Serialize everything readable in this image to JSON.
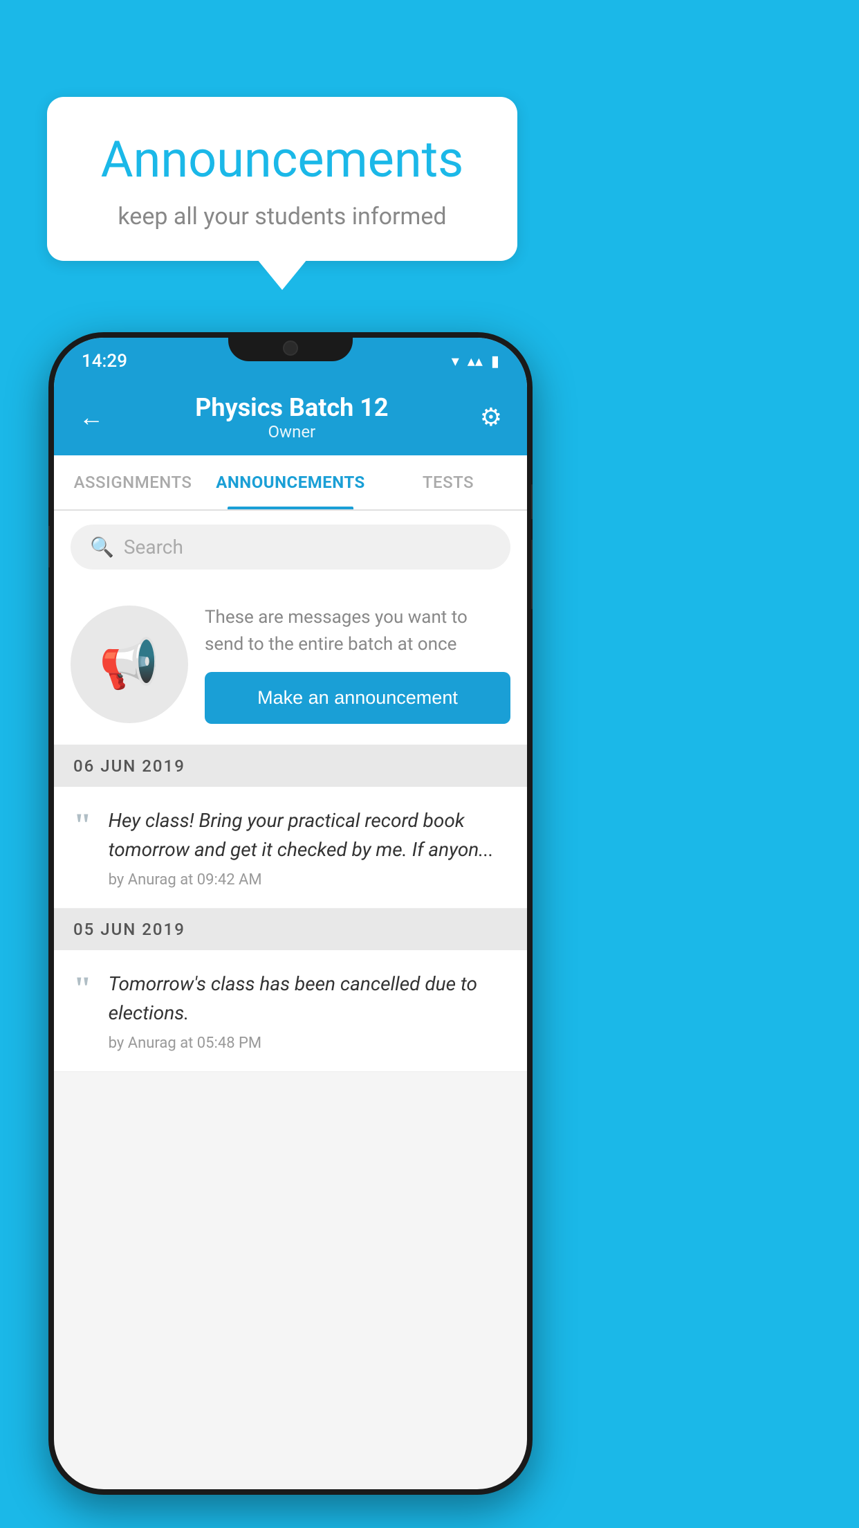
{
  "background_color": "#1bb8e8",
  "speech_bubble": {
    "title": "Announcements",
    "subtitle": "keep all your students informed"
  },
  "status_bar": {
    "time": "14:29",
    "wifi": "▾",
    "signal": "▴",
    "battery": "▮"
  },
  "header": {
    "title": "Physics Batch 12",
    "subtitle": "Owner",
    "back_label": "←",
    "settings_label": "⚙"
  },
  "tabs": [
    {
      "label": "ASSIGNMENTS",
      "active": false
    },
    {
      "label": "ANNOUNCEMENTS",
      "active": true
    },
    {
      "label": "TESTS",
      "active": false
    }
  ],
  "search": {
    "placeholder": "Search"
  },
  "promo": {
    "description": "These are messages you want to send to the entire batch at once",
    "button_label": "Make an announcement"
  },
  "date_sections": [
    {
      "date": "06  JUN  2019",
      "items": [
        {
          "text": "Hey class! Bring your practical record book tomorrow and get it checked by me. If anyon...",
          "meta": "by Anurag at 09:42 AM"
        }
      ]
    },
    {
      "date": "05  JUN  2019",
      "items": [
        {
          "text": "Tomorrow's class has been cancelled due to elections.",
          "meta": "by Anurag at 05:48 PM"
        }
      ]
    }
  ]
}
